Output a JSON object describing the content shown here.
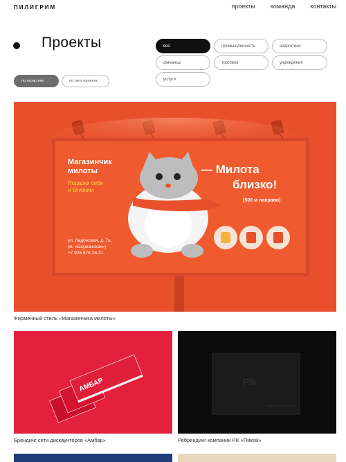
{
  "header": {
    "logo": "ПИЛИГРИМ",
    "nav": [
      "проекты",
      "команда",
      "контакты"
    ]
  },
  "title": "Проекты",
  "industry_filters": [
    "все",
    "промышленность",
    "энергетика",
    "финансы",
    "торговля",
    "учреждения",
    "услуги"
  ],
  "view_toggle": [
    "по отраслям",
    "по типу проекта"
  ],
  "billboard": {
    "shop_name": "Магазинчик милоты",
    "sub": "Подарки себе и близким",
    "address": "ул. Ладожская, д. 7а (м. «Бауманская»)",
    "phone": "+7 926 878-26-21",
    "slogan": "— Милота близко!",
    "distance": "(500 м направо)"
  },
  "booklet_text": "АМБАР",
  "dark_logo": "Plk",
  "projects": [
    "Фирменный стиль «Магазинчика милоты»",
    "Брендинг сети дискаунтеров «Амбар»",
    "Ребрендинг компании PK «Пикей»"
  ],
  "colors": {
    "accent": "#e8502c",
    "red": "#e4213c",
    "dark": "#0c0c0c"
  }
}
